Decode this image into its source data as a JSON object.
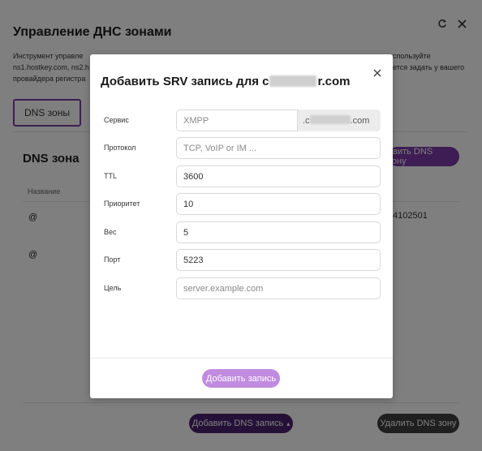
{
  "background": {
    "title": "Управление ДНС зонами",
    "description_left": "Инструмент управле... DNS ... й ... DNS ... HOSTKEY. Используйте ns1.hostkey.com, ns2.h...",
    "description_line1_left": "Инструмент управле",
    "description_line1_right": "спользуйте",
    "description_line2_left": "ns1.hostkey.com, ns2.h",
    "description_line2_right": "ется задать у вашего",
    "description_line3_left": "провайдера регистра",
    "tab_label": "DNS зоны",
    "zone_title": "DNS зона",
    "add_zone_label": "авить DNS зону",
    "column_name": "Название",
    "row1_name": "@",
    "row2_name": "@",
    "serial_value": "4102501",
    "add_record_label": "Добавить DNS запись",
    "add_record_caret": "▴",
    "delete_zone_label": "Удалить DNS зону"
  },
  "modal": {
    "title_prefix": "Добавить SRV запись для с",
    "title_suffix": "r.com",
    "fields": {
      "service": {
        "label": "Сервис",
        "placeholder": "XMPP",
        "suffix_prefix": ".c",
        "suffix_end": ".com"
      },
      "protocol": {
        "label": "Протокол",
        "placeholder": "TCP, VoIP or IM ..."
      },
      "ttl": {
        "label": "TTL",
        "value": "3600"
      },
      "priority": {
        "label": "Приоритет",
        "value": "10"
      },
      "weight": {
        "label": "Вес",
        "value": "5"
      },
      "port": {
        "label": "Порт",
        "value": "5223"
      },
      "target": {
        "label": "Цель",
        "placeholder": "server.example.com"
      }
    },
    "submit_label": "Добавить запись"
  },
  "icons": {
    "refresh": "refresh-icon",
    "close": "close-icon"
  },
  "colors": {
    "accent": "#7a3aa6",
    "accent_light": "#c08be0",
    "dark_button": "#4b2270"
  }
}
